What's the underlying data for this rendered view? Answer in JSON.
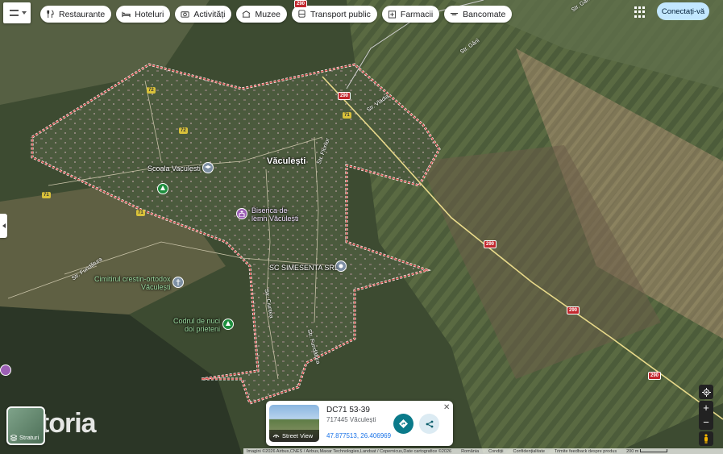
{
  "toolbar": {
    "chips": [
      {
        "label": "Restaurante",
        "icon": "fork-knife-icon"
      },
      {
        "label": "Hoteluri",
        "icon": "bed-icon"
      },
      {
        "label": "Activități",
        "icon": "camera-icon"
      },
      {
        "label": "Muzee",
        "icon": "museum-icon"
      },
      {
        "label": "Transport public",
        "icon": "bus-icon"
      },
      {
        "label": "Farmacii",
        "icon": "pharmacy-icon"
      },
      {
        "label": "Bancomate",
        "icon": "atm-icon"
      }
    ],
    "signin_label": "Conectați-vă"
  },
  "map": {
    "town_label": "Văculești",
    "places": [
      {
        "name": "Scoala Vaculesti",
        "kind": "school"
      },
      {
        "name": "Biserica de lemn Văculești",
        "kind": "church"
      },
      {
        "name": "SC SIMESENTA SRL",
        "kind": "business"
      },
      {
        "name": "Cimitirul crestin-ortodox Văculești",
        "kind": "cemetery"
      },
      {
        "name": "Codrul de nuci doi prieteni",
        "kind": "park"
      }
    ],
    "place_lines": {
      "biserica": [
        "Biserica de",
        "lemn Văculești"
      ],
      "cimitir": [
        "Cimitirul crestin-ortodox",
        "Văculești"
      ],
      "codrul": [
        "Codrul de nuci",
        "doi prieteni"
      ]
    },
    "roads": [
      "Str. Gării",
      "Str. Gării",
      "Str. Vladia",
      "Str. Florilor",
      "Str. Ciuntea",
      "Str. Fundătura",
      "Str. Fundătura"
    ],
    "route_shields": [
      "72",
      "72",
      "71",
      "71",
      "71",
      "290",
      "290",
      "290",
      "290",
      "290"
    ],
    "colors": {
      "boundary": "#d9534f",
      "main_road": "#e8d98a"
    }
  },
  "watermark": "storia",
  "layers_label": "Straturi",
  "info_card": {
    "title": "DC71 53-39",
    "subtitle": "717445 Văculești",
    "coordinates": "47.877513, 26.406969",
    "street_view_label": "Street View"
  },
  "attribution": {
    "imagery": "Imagini ©2026 Airbus,CNES / Airbus,Maxar Technologies,Landsat / Copernicus,Date cartografice ©2026",
    "links": [
      "România",
      "Condiții",
      "Confidențialitate",
      "Trimite feedback despre produs"
    ],
    "scale": "200 m"
  }
}
